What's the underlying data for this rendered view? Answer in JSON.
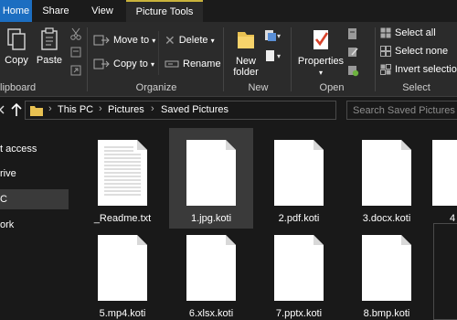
{
  "tabs": {
    "home": "Home",
    "share": "Share",
    "view": "View",
    "picture_tools": "Picture Tools"
  },
  "ribbon": {
    "clipboard": {
      "label": "lipboard",
      "copy": "Copy",
      "paste": "Paste"
    },
    "organize": {
      "label": "Organize",
      "move_to": "Move to",
      "copy_to": "Copy to",
      "delete": "Delete",
      "rename": "Rename"
    },
    "new": {
      "label": "New",
      "new_folder_line1": "New",
      "new_folder_line2": "folder"
    },
    "open": {
      "label": "Open",
      "properties": "Properties"
    },
    "select": {
      "label": "Select",
      "select_all": "Select all",
      "select_none": "Select none",
      "invert_selection": "Invert selection"
    }
  },
  "address": {
    "crumbs": [
      "This PC",
      "Pictures",
      "Saved Pictures"
    ],
    "search_placeholder": "Search Saved Pictures"
  },
  "nav": {
    "items": [
      "t access",
      "rive",
      "C",
      "ork"
    ],
    "selected_index": 2
  },
  "files": [
    {
      "name": "_Readme.txt",
      "type": "text"
    },
    {
      "name": "1.jpg.koti",
      "type": "blank",
      "selected": true
    },
    {
      "name": "2.pdf.koti",
      "type": "blank"
    },
    {
      "name": "3.docx.koti",
      "type": "blank"
    },
    {
      "name": "4",
      "type": "blank"
    },
    {
      "name": "5.mp4.koti",
      "type": "blank"
    },
    {
      "name": "6.xlsx.koti",
      "type": "blank"
    },
    {
      "name": "7.pptx.koti",
      "type": "blank"
    },
    {
      "name": "8.bmp.koti",
      "type": "blank"
    }
  ],
  "colors": {
    "accent": "#1c6ec1",
    "contextual_tab": "#c9b33c",
    "background": "#191919",
    "ribbon": "#2b2b2b"
  }
}
